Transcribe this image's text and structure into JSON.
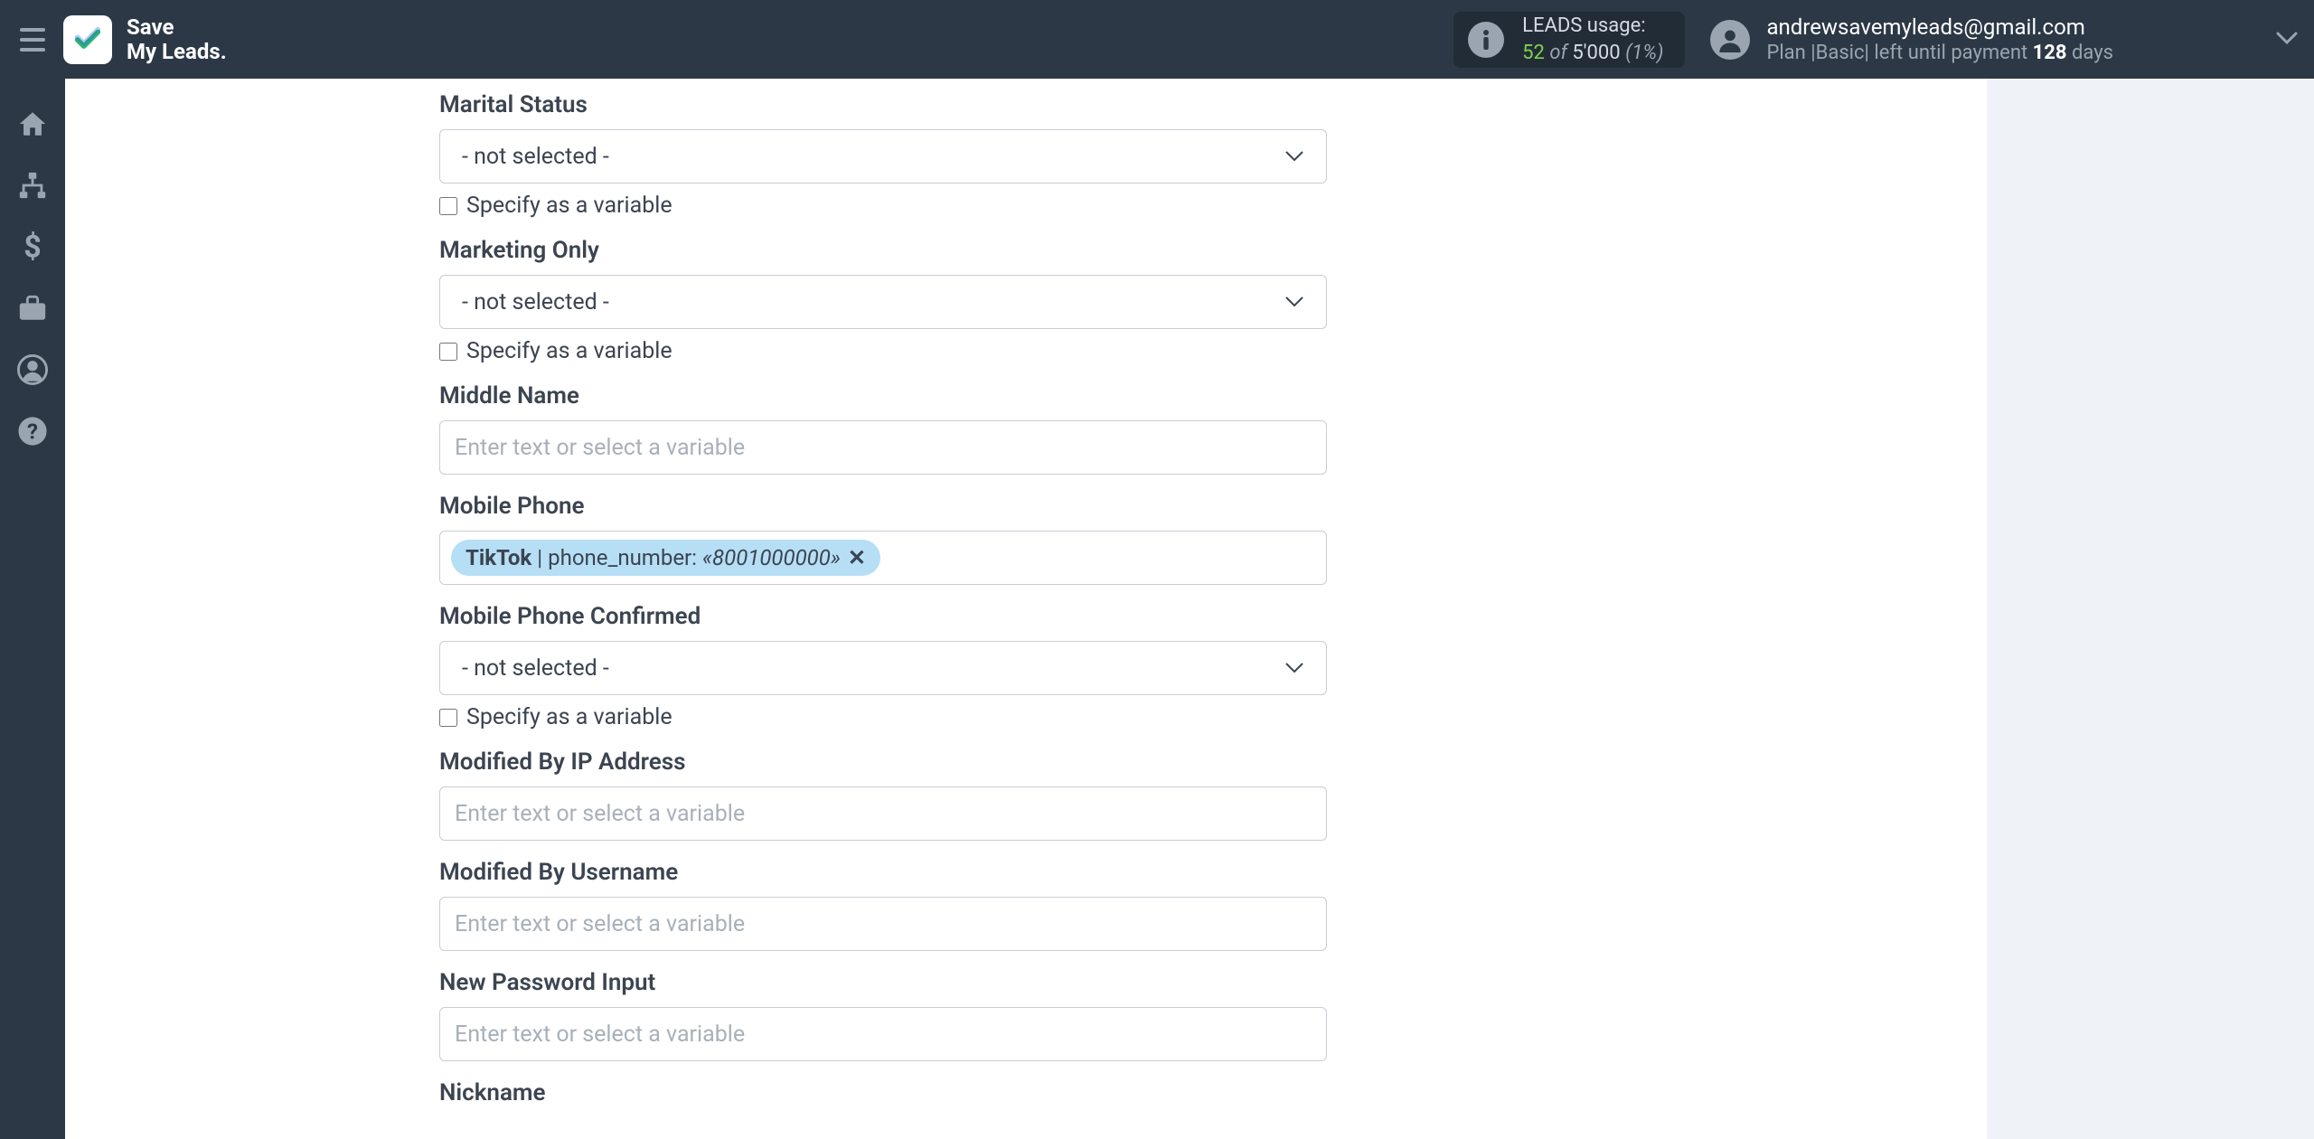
{
  "header": {
    "brand_line1": "Save",
    "brand_line2": "My Leads.",
    "leads_usage": {
      "label": "LEADS usage:",
      "used": "52",
      "of_word": "of",
      "total": "5'000",
      "percent": "(1%)"
    },
    "user": {
      "email": "andrewsavemyleads@gmail.com",
      "plan_prefix": "Plan |",
      "plan_name": "Basic",
      "plan_mid": "| left until payment",
      "days_num": "128",
      "days_word": "days"
    }
  },
  "sidebar": {
    "items": [
      "home",
      "sitemap",
      "dollar",
      "briefcase",
      "user",
      "question"
    ]
  },
  "form": {
    "not_selected": "- not selected -",
    "placeholder": "Enter text or select a variable",
    "specify_variable": "Specify as a variable",
    "fields": {
      "marital_status": {
        "label": "Marital Status"
      },
      "marketing_only": {
        "label": "Marketing Only"
      },
      "middle_name": {
        "label": "Middle Name"
      },
      "mobile_phone": {
        "label": "Mobile Phone",
        "tag": {
          "source": "TikTok",
          "key": "phone_number:",
          "value": "«8001000000»"
        }
      },
      "mobile_phone_confirmed": {
        "label": "Mobile Phone Confirmed"
      },
      "modified_by_ip": {
        "label": "Modified By IP Address"
      },
      "modified_by_username": {
        "label": "Modified By Username"
      },
      "new_password_input": {
        "label": "New Password Input"
      },
      "nickname": {
        "label": "Nickname"
      }
    }
  }
}
